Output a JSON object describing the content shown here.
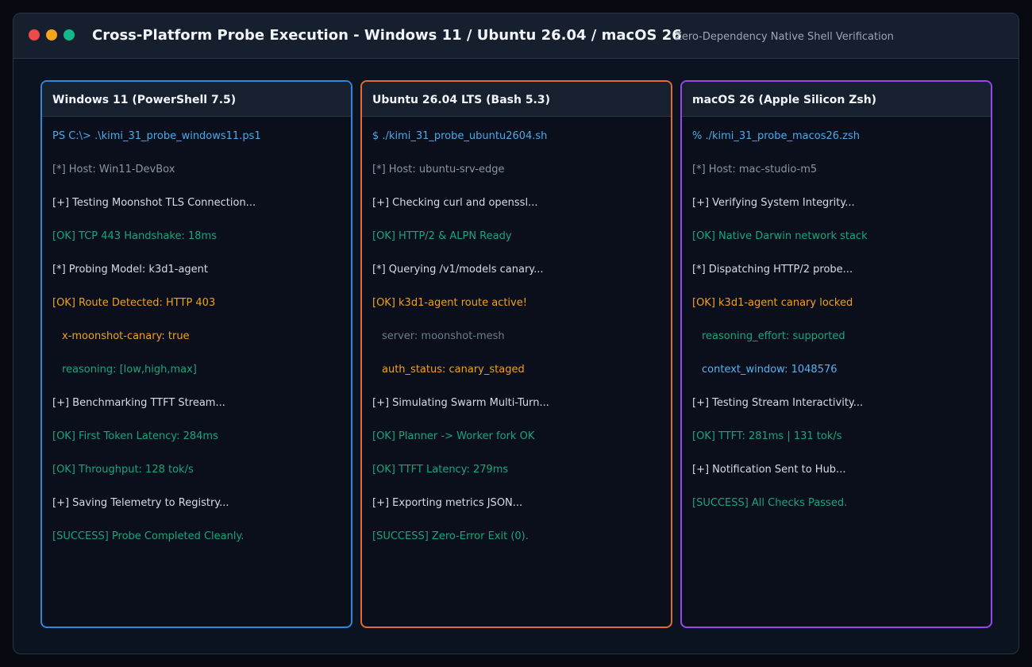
{
  "window": {
    "title": "Cross-Platform Probe Execution - Windows 11 / Ubuntu 26.04 / macOS 26",
    "subtitle": "Zero-Dependency Native Shell Verification"
  },
  "colors": {
    "windows_accent": "#2f86da",
    "ubuntu_accent": "#e46a34",
    "macos_accent": "#9747f0",
    "success": "#17a57d",
    "warning": "#f0a01f",
    "command": "#4ea8e6"
  },
  "panels": {
    "windows": {
      "header": "Windows 11 (PowerShell 7.5)",
      "lines": [
        {
          "text": "PS C:\\> .\\kimi_31_probe_windows11.ps1"
        },
        {
          "text": "[*] Host: Win11-DevBox"
        },
        {
          "text": "[+] Testing Moonshot TLS Connection..."
        },
        {
          "text": "[OK] TCP 443 Handshake: 18ms"
        },
        {
          "text": "[*] Probing Model: k3d1-agent"
        },
        {
          "text": "[OK] Route Detected: HTTP 403"
        },
        {
          "text": "x-moonshot-canary: true"
        },
        {
          "text": "reasoning: [low,high,max]"
        },
        {
          "text": "[+] Benchmarking TTFT Stream..."
        },
        {
          "text": "[OK] First Token Latency: 284ms"
        },
        {
          "text": "[OK] Throughput: 128 tok/s"
        },
        {
          "text": "[+] Saving Telemetry to Registry..."
        },
        {
          "text": "[SUCCESS] Probe Completed Cleanly."
        }
      ]
    },
    "ubuntu": {
      "header": "Ubuntu 26.04 LTS (Bash 5.3)",
      "lines": [
        {
          "text": "$ ./kimi_31_probe_ubuntu2604.sh"
        },
        {
          "text": "[*] Host: ubuntu-srv-edge"
        },
        {
          "text": "[+] Checking curl and openssl..."
        },
        {
          "text": "[OK] HTTP/2 & ALPN Ready"
        },
        {
          "text": "[*] Querying /v1/models canary..."
        },
        {
          "text": "[OK] k3d1-agent route active!"
        },
        {
          "text": "server: moonshot-mesh"
        },
        {
          "text": "auth_status: canary_staged"
        },
        {
          "text": "[+] Simulating Swarm Multi-Turn..."
        },
        {
          "text": "[OK] Planner -> Worker fork OK"
        },
        {
          "text": "[OK] TTFT Latency: 279ms"
        },
        {
          "text": "[+] Exporting metrics JSON..."
        },
        {
          "text": "[SUCCESS] Zero-Error Exit (0)."
        }
      ]
    },
    "macos": {
      "header": "macOS 26 (Apple Silicon Zsh)",
      "lines": [
        {
          "text": "% ./kimi_31_probe_macos26.zsh"
        },
        {
          "text": "[*] Host: mac-studio-m5"
        },
        {
          "text": "[+] Verifying System Integrity..."
        },
        {
          "text": "[OK] Native Darwin network stack"
        },
        {
          "text": "[*] Dispatching HTTP/2 probe..."
        },
        {
          "text": "[OK] k3d1-agent canary locked"
        },
        {
          "text": "reasoning_effort: supported"
        },
        {
          "text": "context_window: 1048576"
        },
        {
          "text": "[+] Testing Stream Interactivity..."
        },
        {
          "text": "[OK] TTFT: 281ms | 131 tok/s"
        },
        {
          "text": "[+] Notification Sent to Hub..."
        },
        {
          "text": "[SUCCESS] All Checks Passed."
        }
      ]
    }
  }
}
